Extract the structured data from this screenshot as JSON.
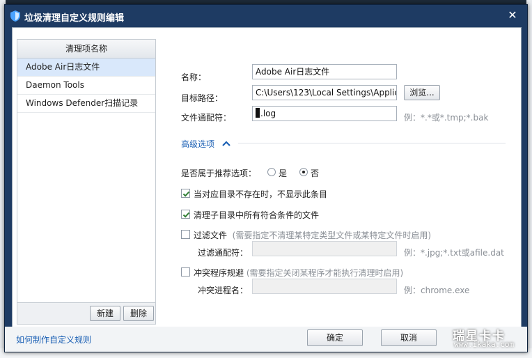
{
  "window": {
    "title": "垃圾清理自定义规则编辑",
    "close_glyph": "✕"
  },
  "list": {
    "header": "清理项名称",
    "items": [
      {
        "label": "Adobe Air日志文件",
        "selected": true
      },
      {
        "label": "Daemon Tools",
        "selected": false
      },
      {
        "label": "Windows Defender扫描记录",
        "selected": false
      }
    ],
    "new_button": "新建",
    "delete_button": "删除"
  },
  "form": {
    "name_label": "名称：",
    "name_value": "Adobe Air日志文件",
    "path_label": "目标路径：",
    "path_value": "C:\\Users\\123\\Local Settings\\Applic",
    "browse_button": "浏览...",
    "pattern_label": "文件通配符：",
    "pattern_value": ".log",
    "pattern_hint": "例：*.*或*.tmp;*.bak",
    "advanced_label": "高级选项",
    "recommend_label": "是否属于推荐选项：",
    "recommend_yes": "是",
    "recommend_no": "否",
    "recommend_selected": "否",
    "hide_if_missing_label": "当对应目录不存在时，不显示此条目",
    "hide_if_missing_checked": true,
    "clean_subdirs_label": "清理子目录中所有符合条件的文件",
    "clean_subdirs_checked": true,
    "filter_label": "过滤文件",
    "filter_checked": false,
    "filter_note": "(需要指定不清理某特定类型文件或某特定文件时启用)",
    "filter_pattern_label": "过滤通配符：",
    "filter_pattern_value": "",
    "filter_hint": "例：*.jpg;*.txt或afile.dat",
    "conflict_label": "冲突程序规避",
    "conflict_checked": false,
    "conflict_note": "(需要指定关闭某程序才能执行清理时启用)",
    "conflict_process_label": "冲突进程名：",
    "conflict_process_value": "",
    "conflict_hint": "例：chrome.exe"
  },
  "footer": {
    "help_link": "如何制作自定义规则",
    "ok_button": "确定",
    "cancel_button": "取消"
  },
  "watermark": {
    "main": "瑞星卡卡",
    "sub": "www.ikaka.com"
  },
  "colors": {
    "titlebar": "#1e3b63",
    "selection": "#d9e8fb",
    "link": "#1a5fb4",
    "check": "#2e7d32"
  },
  "icons": {
    "title": "shield-icon",
    "advanced": "chevron-up-icon",
    "close": "close-icon"
  }
}
